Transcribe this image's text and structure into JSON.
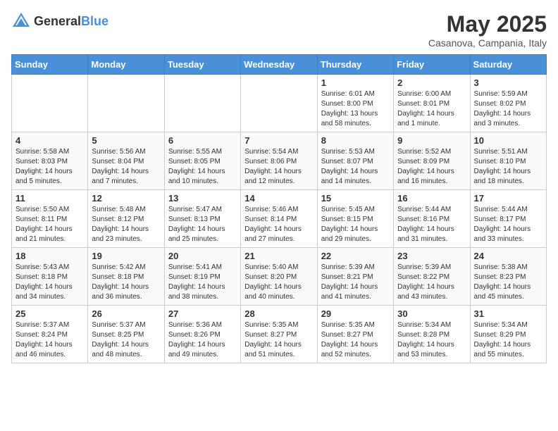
{
  "logo": {
    "general": "General",
    "blue": "Blue"
  },
  "title": {
    "month": "May 2025",
    "location": "Casanova, Campania, Italy"
  },
  "days_header": [
    "Sunday",
    "Monday",
    "Tuesday",
    "Wednesday",
    "Thursday",
    "Friday",
    "Saturday"
  ],
  "weeks": [
    [
      {
        "day": "",
        "info": ""
      },
      {
        "day": "",
        "info": ""
      },
      {
        "day": "",
        "info": ""
      },
      {
        "day": "",
        "info": ""
      },
      {
        "day": "1",
        "info": "Sunrise: 6:01 AM\nSunset: 8:00 PM\nDaylight: 13 hours and 58 minutes."
      },
      {
        "day": "2",
        "info": "Sunrise: 6:00 AM\nSunset: 8:01 PM\nDaylight: 14 hours and 1 minute."
      },
      {
        "day": "3",
        "info": "Sunrise: 5:59 AM\nSunset: 8:02 PM\nDaylight: 14 hours and 3 minutes."
      }
    ],
    [
      {
        "day": "4",
        "info": "Sunrise: 5:58 AM\nSunset: 8:03 PM\nDaylight: 14 hours and 5 minutes."
      },
      {
        "day": "5",
        "info": "Sunrise: 5:56 AM\nSunset: 8:04 PM\nDaylight: 14 hours and 7 minutes."
      },
      {
        "day": "6",
        "info": "Sunrise: 5:55 AM\nSunset: 8:05 PM\nDaylight: 14 hours and 10 minutes."
      },
      {
        "day": "7",
        "info": "Sunrise: 5:54 AM\nSunset: 8:06 PM\nDaylight: 14 hours and 12 minutes."
      },
      {
        "day": "8",
        "info": "Sunrise: 5:53 AM\nSunset: 8:07 PM\nDaylight: 14 hours and 14 minutes."
      },
      {
        "day": "9",
        "info": "Sunrise: 5:52 AM\nSunset: 8:09 PM\nDaylight: 14 hours and 16 minutes."
      },
      {
        "day": "10",
        "info": "Sunrise: 5:51 AM\nSunset: 8:10 PM\nDaylight: 14 hours and 18 minutes."
      }
    ],
    [
      {
        "day": "11",
        "info": "Sunrise: 5:50 AM\nSunset: 8:11 PM\nDaylight: 14 hours and 21 minutes."
      },
      {
        "day": "12",
        "info": "Sunrise: 5:48 AM\nSunset: 8:12 PM\nDaylight: 14 hours and 23 minutes."
      },
      {
        "day": "13",
        "info": "Sunrise: 5:47 AM\nSunset: 8:13 PM\nDaylight: 14 hours and 25 minutes."
      },
      {
        "day": "14",
        "info": "Sunrise: 5:46 AM\nSunset: 8:14 PM\nDaylight: 14 hours and 27 minutes."
      },
      {
        "day": "15",
        "info": "Sunrise: 5:45 AM\nSunset: 8:15 PM\nDaylight: 14 hours and 29 minutes."
      },
      {
        "day": "16",
        "info": "Sunrise: 5:44 AM\nSunset: 8:16 PM\nDaylight: 14 hours and 31 minutes."
      },
      {
        "day": "17",
        "info": "Sunrise: 5:44 AM\nSunset: 8:17 PM\nDaylight: 14 hours and 33 minutes."
      }
    ],
    [
      {
        "day": "18",
        "info": "Sunrise: 5:43 AM\nSunset: 8:18 PM\nDaylight: 14 hours and 34 minutes."
      },
      {
        "day": "19",
        "info": "Sunrise: 5:42 AM\nSunset: 8:18 PM\nDaylight: 14 hours and 36 minutes."
      },
      {
        "day": "20",
        "info": "Sunrise: 5:41 AM\nSunset: 8:19 PM\nDaylight: 14 hours and 38 minutes."
      },
      {
        "day": "21",
        "info": "Sunrise: 5:40 AM\nSunset: 8:20 PM\nDaylight: 14 hours and 40 minutes."
      },
      {
        "day": "22",
        "info": "Sunrise: 5:39 AM\nSunset: 8:21 PM\nDaylight: 14 hours and 41 minutes."
      },
      {
        "day": "23",
        "info": "Sunrise: 5:39 AM\nSunset: 8:22 PM\nDaylight: 14 hours and 43 minutes."
      },
      {
        "day": "24",
        "info": "Sunrise: 5:38 AM\nSunset: 8:23 PM\nDaylight: 14 hours and 45 minutes."
      }
    ],
    [
      {
        "day": "25",
        "info": "Sunrise: 5:37 AM\nSunset: 8:24 PM\nDaylight: 14 hours and 46 minutes."
      },
      {
        "day": "26",
        "info": "Sunrise: 5:37 AM\nSunset: 8:25 PM\nDaylight: 14 hours and 48 minutes."
      },
      {
        "day": "27",
        "info": "Sunrise: 5:36 AM\nSunset: 8:26 PM\nDaylight: 14 hours and 49 minutes."
      },
      {
        "day": "28",
        "info": "Sunrise: 5:35 AM\nSunset: 8:27 PM\nDaylight: 14 hours and 51 minutes."
      },
      {
        "day": "29",
        "info": "Sunrise: 5:35 AM\nSunset: 8:27 PM\nDaylight: 14 hours and 52 minutes."
      },
      {
        "day": "30",
        "info": "Sunrise: 5:34 AM\nSunset: 8:28 PM\nDaylight: 14 hours and 53 minutes."
      },
      {
        "day": "31",
        "info": "Sunrise: 5:34 AM\nSunset: 8:29 PM\nDaylight: 14 hours and 55 minutes."
      }
    ]
  ]
}
